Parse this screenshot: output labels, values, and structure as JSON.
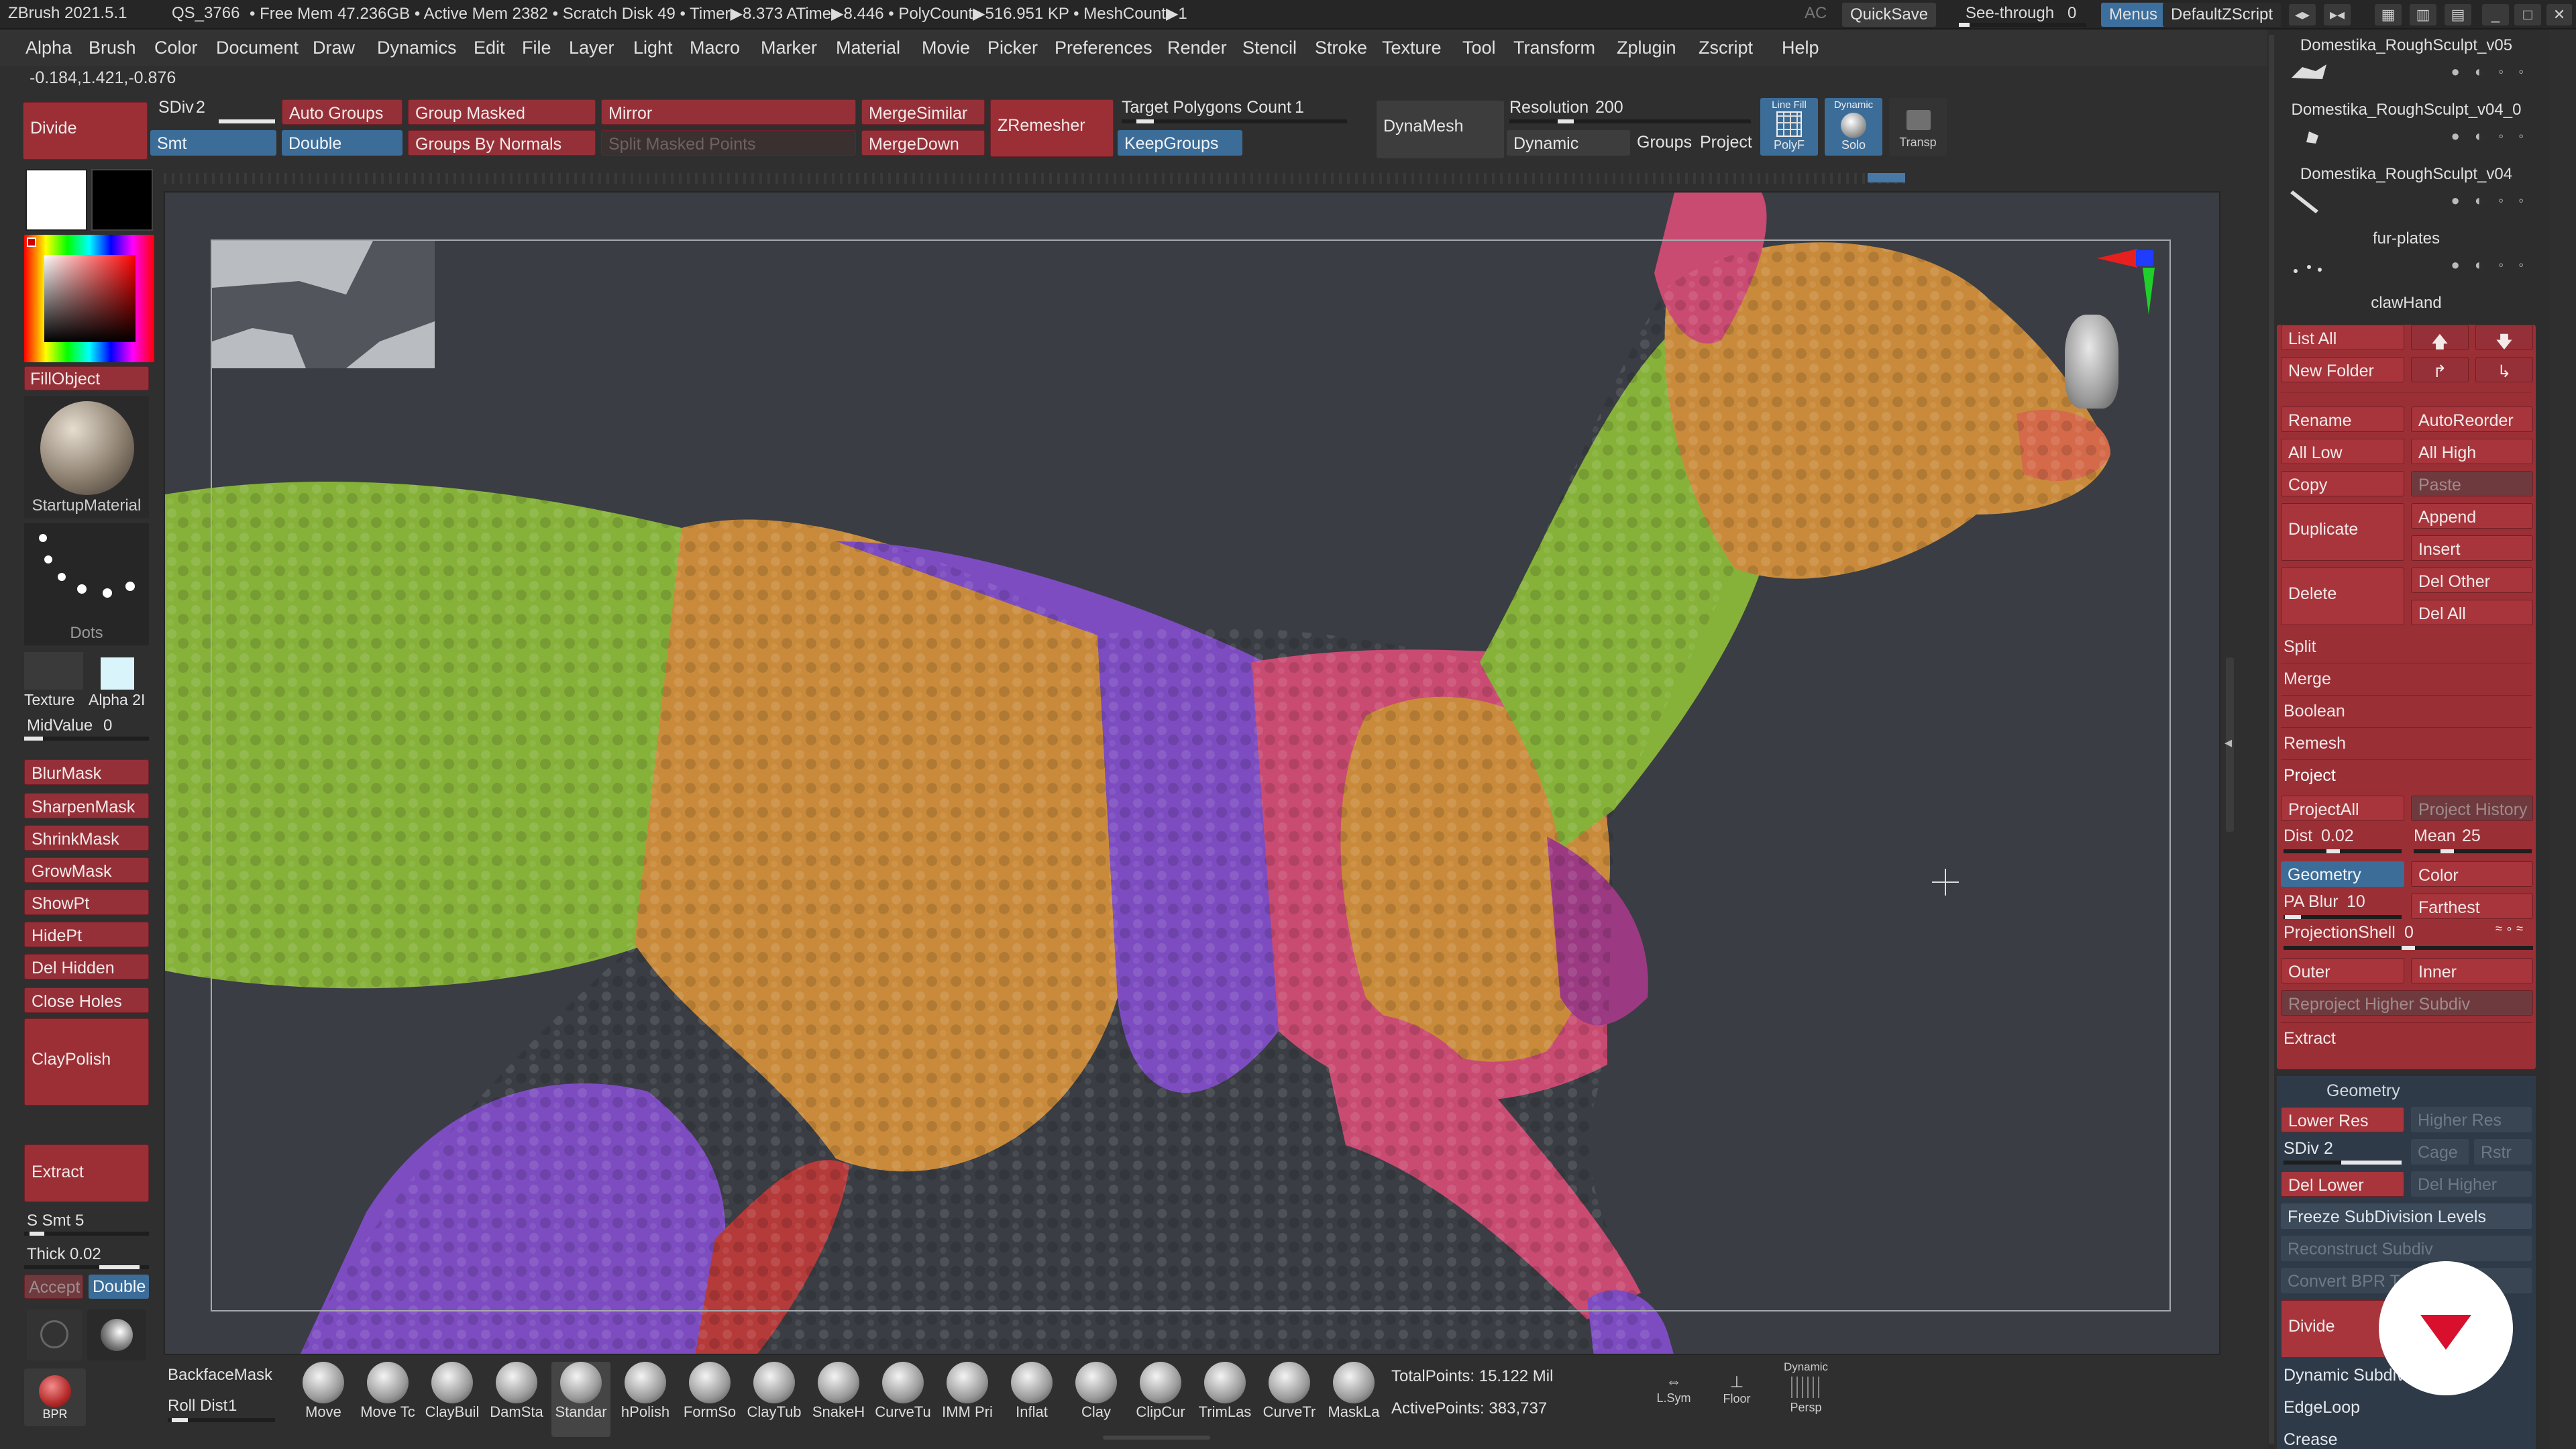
{
  "titlebar": {
    "app": "ZBrush 2021.5.1",
    "project": "QS_3766",
    "free_mem": "• Free Mem 47.236GB • Active Mem 2382 • Scratch Disk 49 • Timer▶8.373 ATime▶8.446 • PolyCount▶516.951 KP • MeshCount▶1",
    "ac": "AC",
    "quicksave": "QuickSave",
    "seethrough_label": "See-through",
    "seethrough_value": "0",
    "menus": "Menus",
    "script": "DefaultZScript"
  },
  "menubar": [
    "Alpha",
    "Brush",
    "Color",
    "Document",
    "Draw",
    "Dynamics",
    "Edit",
    "File",
    "Layer",
    "Light",
    "Macro",
    "Marker",
    "Material",
    "Movie",
    "Picker",
    "Preferences",
    "Render",
    "Stencil",
    "Stroke",
    "Texture",
    "Tool",
    "Transform",
    "Zplugin",
    "Zscript",
    "Help"
  ],
  "coords": "-0.184,1.421,-0.876",
  "toolbar": {
    "divide": "Divide",
    "sdiv_label": "SDiv",
    "sdiv_value": "2",
    "smt": "Smt",
    "auto_groups": "Auto Groups",
    "double": "Double",
    "group_masked": "Group Masked",
    "groups_by_normals": "Groups By Normals",
    "mirror": "Mirror",
    "split_masked_points": "Split Masked Points",
    "merge_similar": "MergeSimilar",
    "merge_down": "MergeDown",
    "zremesher": "ZRemesher",
    "target_polygons_label": "Target Polygons Count",
    "target_polygons_value": "1",
    "keep_groups": "KeepGroups",
    "dynamesh": "DynaMesh",
    "resolution_label": "Resolution",
    "resolution_value": "200",
    "dynamic": "Dynamic",
    "groups": "Groups",
    "project": "Project",
    "polyf_top": "Line Fill",
    "polyf": "PolyF",
    "solo_top": "Dynamic",
    "solo": "Solo",
    "transp": "Transp"
  },
  "left": {
    "fill_object": "FillObject",
    "material": "StartupMaterial",
    "stroke": "Dots",
    "texture": "Texture",
    "alpha": "Alpha 2I",
    "midvalue_label": "MidValue",
    "midvalue_value": "0",
    "blurmask": "BlurMask",
    "sharpenmask": "SharpenMask",
    "shrinkmask": "ShrinkMask",
    "growmask": "GrowMask",
    "showpt": "ShowPt",
    "hidept": "HidePt",
    "delhidden": "Del Hidden",
    "closeholes": "Close Holes",
    "claypolish": "ClayPolish",
    "extract": "Extract",
    "ssmt_label": "S Smt",
    "ssmt_value": "5",
    "thick_label": "Thick",
    "thick_value": "0.02",
    "accept": "Accept",
    "double": "Double",
    "bpr": "BPR"
  },
  "shelf": {
    "backface": "BackfaceMask",
    "rolldist_label": "Roll Dist",
    "rolldist_value": "1",
    "brushes": [
      "Move",
      "Move Tc",
      "ClayBuil",
      "DamSta",
      "Standar",
      "hPolish",
      "FormSo",
      "ClayTub",
      "SnakeH",
      "CurveTu",
      "IMM Pri",
      "Inflat",
      "Clay",
      "ClipCur",
      "TrimLas",
      "CurveTr",
      "MaskLa"
    ],
    "total_points": "TotalPoints: 15.122 Mil",
    "active_points": "ActivePoints: 383,737",
    "lsym": "L.Sym",
    "floor": "Floor",
    "persp_top": "Dynamic",
    "persp": "Persp"
  },
  "subtools": [
    "Domestika_RoughSculpt_v05",
    "Domestika_RoughSculpt_v04_0",
    "Domestika_RoughSculpt_v04",
    "fur-plates",
    "clawHand"
  ],
  "subtool_panel": {
    "list_all": "List All",
    "new_folder": "New Folder",
    "rename": "Rename",
    "auto_reorder": "AutoReorder",
    "all_low": "All Low",
    "all_high": "All High",
    "copy": "Copy",
    "paste": "Paste",
    "duplicate": "Duplicate",
    "append": "Append",
    "insert": "Insert",
    "delete": "Delete",
    "del_other": "Del Other",
    "del_all": "Del All",
    "split": "Split",
    "merge": "Merge",
    "boolean": "Boolean",
    "remesh": "Remesh",
    "project": "Project",
    "project_all": "ProjectAll",
    "project_history": "Project History",
    "dist_label": "Dist",
    "dist_value": "0.02",
    "mean_label": "Mean",
    "mean_value": "25",
    "geometry": "Geometry",
    "color": "Color",
    "pa_blur_label": "PA Blur",
    "pa_blur_value": "10",
    "farthest": "Farthest",
    "projection_shell_label": "ProjectionShell",
    "projection_shell_value": "0",
    "outer": "Outer",
    "inner": "Inner",
    "reproject": "Reproject Higher Subdiv",
    "extract": "Extract"
  },
  "geometry_panel": {
    "title": "Geometry",
    "lower_res": "Lower Res",
    "higher_res": "Higher Res",
    "sdiv_label": "SDiv",
    "sdiv_value": "2",
    "cage": "Cage",
    "rstr": "Rstr",
    "del_lower": "Del Lower",
    "del_higher": "Del Higher",
    "freeze": "Freeze SubDivision Levels",
    "reconstruct": "Reconstruct Subdiv",
    "convert_bpr": "Convert BPR To",
    "divide": "Divide",
    "dynamic_subdiv": "Dynamic Subdiv",
    "edgeloop": "EdgeLoop",
    "crease": "Crease"
  },
  "colors": {
    "accent_red": "#9b2f36",
    "accent_blue": "#3c6d98",
    "polygroup_green": "#86b23a",
    "polygroup_tan": "#c98b3b",
    "polygroup_purple": "#7c4cc0",
    "polygroup_pink": "#c94b72",
    "logo_red": "#d8102e"
  }
}
